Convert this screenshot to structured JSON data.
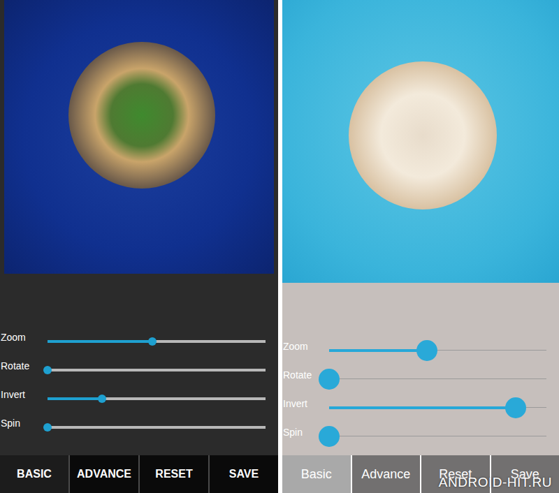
{
  "panels": [
    {
      "kind": "dark",
      "sliders": [
        {
          "label": "Zoom",
          "level": 0.48
        },
        {
          "label": "Rotate",
          "level": 0.0
        },
        {
          "label": "Invert",
          "level": 0.25
        },
        {
          "label": "Spin",
          "level": 0.0
        }
      ],
      "buttons": [
        {
          "label": "BASIC",
          "selected": true
        },
        {
          "label": "ADVANCE",
          "selected": false
        },
        {
          "label": "RESET",
          "selected": false
        },
        {
          "label": "SAVE",
          "selected": false
        }
      ]
    },
    {
      "kind": "light",
      "sliders": [
        {
          "label": "Zoom",
          "level": 0.45
        },
        {
          "label": "Rotate",
          "level": 0.0
        },
        {
          "label": "Invert",
          "level": 0.86
        },
        {
          "label": "Spin",
          "level": 0.0
        }
      ],
      "buttons": [
        {
          "label": "Basic",
          "selected": true
        },
        {
          "label": "Advance",
          "selected": false
        },
        {
          "label": "Reset",
          "selected": false
        },
        {
          "label": "Save",
          "selected": false
        }
      ]
    }
  ],
  "watermark": "ANDROID-HIT.RU"
}
